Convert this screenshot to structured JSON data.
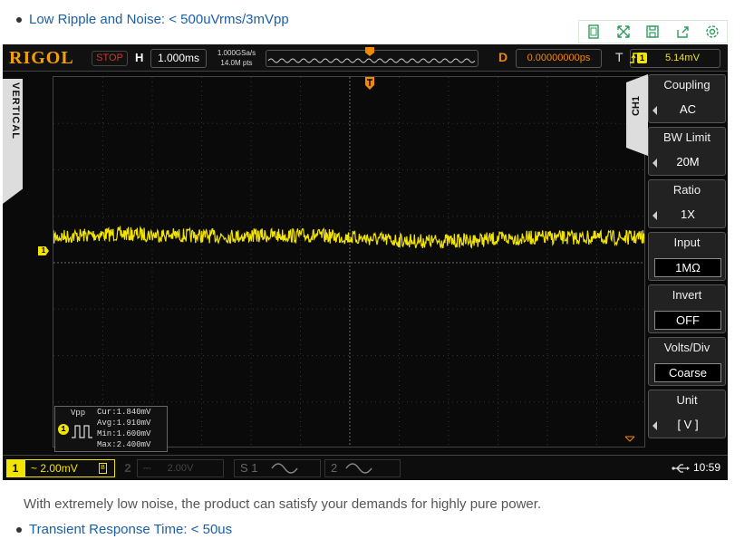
{
  "page": {
    "bullet_top": "Low Ripple and Noise: < 500uVrms/3mVpp",
    "description": "With extremely low noise, the product can satisfy your demands for highly pure power.",
    "bullet_bottom": "Transient Response Time: < 50us"
  },
  "toolbar": {
    "icons": [
      "copy-icon",
      "expand-icon",
      "save-icon",
      "share-icon",
      "settings-icon"
    ],
    "accent_color": "#2f9c5a"
  },
  "scope": {
    "brand": "RIGOL",
    "run_state": "STOP",
    "horizontal_label": "H",
    "timebase": "1.000ms",
    "sample_rate": "1.000GSa/s",
    "memory_depth": "14.0M pts",
    "delay_label": "D",
    "delay_value": "0.00000000ps",
    "trigger_label": "T",
    "trigger_source": "1",
    "trigger_level": "5.14mV",
    "vertical_tab": "VERTICAL",
    "channel_tab": "CH1",
    "channel_marker": "1",
    "trace_color": "#f2e400",
    "measurement": {
      "name": "Vpp",
      "channel": "1",
      "cur": "Cur:1.840mV",
      "avg": "Avg:1.910mV",
      "min": "Min:1.600mV",
      "max": "Max:2.400mV"
    },
    "menu": [
      {
        "title": "Coupling",
        "value": "AC"
      },
      {
        "title": "BW Limit",
        "value": "20M"
      },
      {
        "title": "Ratio",
        "value": "1X"
      },
      {
        "title": "Input",
        "value": "1MΩ"
      },
      {
        "title": "Invert",
        "value": "OFF"
      },
      {
        "title": "Volts/Div",
        "value": "Coarse"
      },
      {
        "title": "Unit",
        "value": "[ V ]"
      }
    ],
    "bottom": {
      "ch1_number": "1",
      "ch1_scale": "~ 2.00mV",
      "ch2_number": "2",
      "ch2_scale": "2.00V",
      "math1": "S 1",
      "math2": "2",
      "time": "10:59"
    }
  }
}
